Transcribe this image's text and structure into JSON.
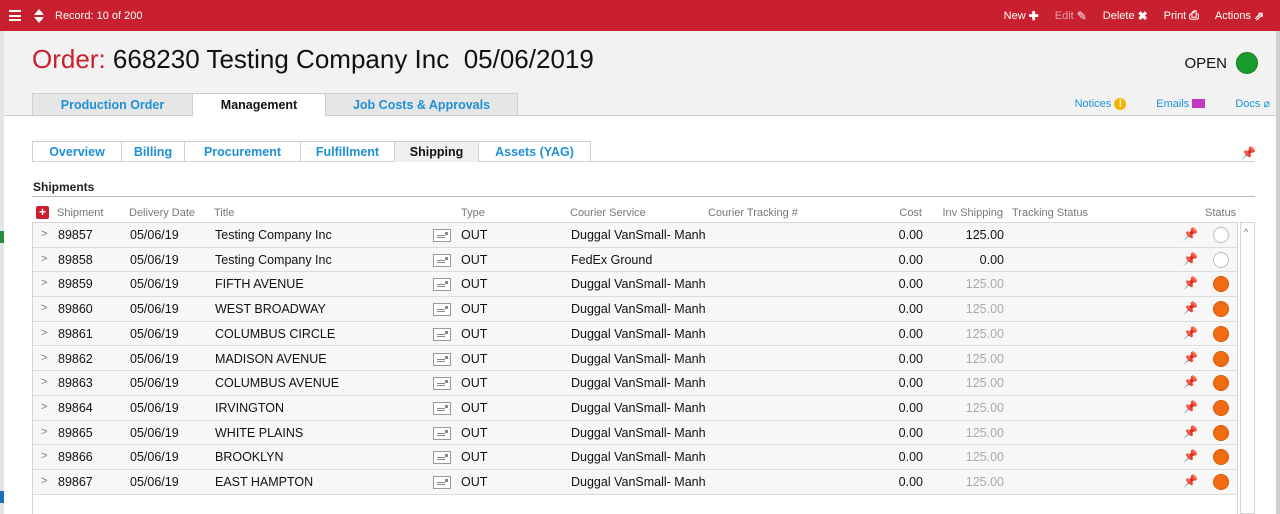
{
  "topbar": {
    "record": "Record: 10 of 200",
    "actions": [
      {
        "label": "New",
        "icon": "plus-icon",
        "glyph": "✚",
        "enabled": true
      },
      {
        "label": "Edit",
        "icon": "pencil-icon",
        "glyph": "✎",
        "enabled": false
      },
      {
        "label": "Delete",
        "icon": "x-icon",
        "glyph": "✖",
        "enabled": true
      },
      {
        "label": "Print",
        "icon": "printer-icon",
        "glyph": "⎙",
        "enabled": true
      },
      {
        "label": "Actions",
        "icon": "external-arrow-icon",
        "glyph": "⇗",
        "enabled": true
      }
    ]
  },
  "order": {
    "label": "Order:",
    "number": "668230",
    "company": "Testing Company Inc",
    "date": "05/06/2019",
    "status": "OPEN",
    "status_color": "#1a9c2c"
  },
  "main_tabs": [
    {
      "label": "Production Order",
      "active": false
    },
    {
      "label": "Management",
      "active": true
    },
    {
      "label": "Job Costs & Approvals",
      "active": false
    }
  ],
  "header_links": [
    {
      "label": "Notices",
      "icon": "notice-icon"
    },
    {
      "label": "Emails",
      "icon": "email-icon"
    },
    {
      "label": "Docs",
      "icon": "paperclip-icon"
    }
  ],
  "sub_tabs": [
    {
      "label": "Overview",
      "active": false
    },
    {
      "label": "Billing",
      "active": false
    },
    {
      "label": "Procurement",
      "active": false
    },
    {
      "label": "Fulfillment",
      "active": false
    },
    {
      "label": "Shipping",
      "active": true
    },
    {
      "label": "Assets (YAG)",
      "active": false
    }
  ],
  "section_title": "Shipments",
  "columns": {
    "shipment": "Shipment",
    "delivery_date": "Delivery Date",
    "title": "Title",
    "type": "Type",
    "courier_service": "Courier Service",
    "courier_tracking": "Courier Tracking #",
    "cost": "Cost",
    "inv_shipping": "Inv Shipping",
    "tracking_status": "Tracking Status",
    "status": "Status"
  },
  "rows": [
    {
      "shipment": "89857",
      "date": "05/06/19",
      "title": "Testing Company Inc",
      "type": "OUT",
      "courier": "Duggal VanSmall- Manh",
      "tracking": "",
      "cost": "0.00",
      "inv": "125.00",
      "inv_muted": false,
      "status": "open"
    },
    {
      "shipment": "89858",
      "date": "05/06/19",
      "title": "Testing Company Inc",
      "type": "OUT",
      "courier": "FedEx Ground",
      "tracking": "",
      "cost": "0.00",
      "inv": "0.00",
      "inv_muted": false,
      "status": "open"
    },
    {
      "shipment": "89859",
      "date": "05/06/19",
      "title": "FIFTH AVENUE",
      "type": "OUT",
      "courier": "Duggal VanSmall- Manh",
      "tracking": "",
      "cost": "0.00",
      "inv": "125.00",
      "inv_muted": true,
      "status": "orange"
    },
    {
      "shipment": "89860",
      "date": "05/06/19",
      "title": "WEST BROADWAY",
      "type": "OUT",
      "courier": "Duggal VanSmall- Manh",
      "tracking": "",
      "cost": "0.00",
      "inv": "125.00",
      "inv_muted": true,
      "status": "orange"
    },
    {
      "shipment": "89861",
      "date": "05/06/19",
      "title": "COLUMBUS CIRCLE",
      "type": "OUT",
      "courier": "Duggal VanSmall- Manh",
      "tracking": "",
      "cost": "0.00",
      "inv": "125.00",
      "inv_muted": true,
      "status": "orange"
    },
    {
      "shipment": "89862",
      "date": "05/06/19",
      "title": "MADISON AVENUE",
      "type": "OUT",
      "courier": "Duggal VanSmall- Manh",
      "tracking": "",
      "cost": "0.00",
      "inv": "125.00",
      "inv_muted": true,
      "status": "orange"
    },
    {
      "shipment": "89863",
      "date": "05/06/19",
      "title": "COLUMBUS AVENUE",
      "type": "OUT",
      "courier": "Duggal VanSmall- Manh",
      "tracking": "",
      "cost": "0.00",
      "inv": "125.00",
      "inv_muted": true,
      "status": "orange"
    },
    {
      "shipment": "89864",
      "date": "05/06/19",
      "title": "IRVINGTON",
      "type": "OUT",
      "courier": "Duggal VanSmall- Manh",
      "tracking": "",
      "cost": "0.00",
      "inv": "125.00",
      "inv_muted": true,
      "status": "orange"
    },
    {
      "shipment": "89865",
      "date": "05/06/19",
      "title": "WHITE PLAINS",
      "type": "OUT",
      "courier": "Duggal VanSmall- Manh",
      "tracking": "",
      "cost": "0.00",
      "inv": "125.00",
      "inv_muted": true,
      "status": "orange"
    },
    {
      "shipment": "89866",
      "date": "05/06/19",
      "title": "BROOKLYN",
      "type": "OUT",
      "courier": "Duggal VanSmall- Manh",
      "tracking": "",
      "cost": "0.00",
      "inv": "125.00",
      "inv_muted": true,
      "status": "orange"
    },
    {
      "shipment": "89867",
      "date": "05/06/19",
      "title": "EAST HAMPTON",
      "type": "OUT",
      "courier": "Duggal VanSmall- Manh",
      "tracking": "",
      "cost": "0.00",
      "inv": "125.00",
      "inv_muted": true,
      "status": "orange"
    }
  ],
  "colors": {
    "brand_red": "#c8202e",
    "link_blue": "#1e90d6",
    "status_open": "#1a9c2c",
    "status_orange": "#f26a12"
  }
}
